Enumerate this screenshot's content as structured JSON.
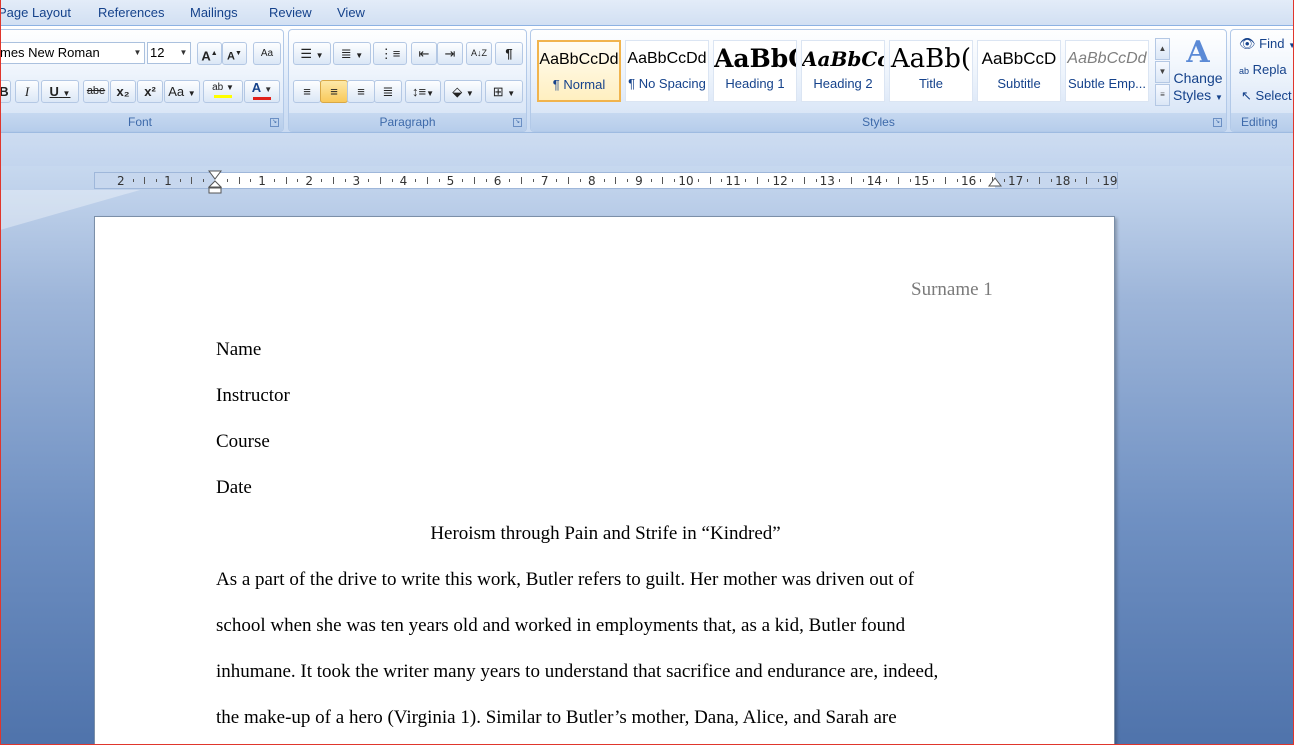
{
  "tabs": [
    "Page Layout",
    "References",
    "Mailings",
    "Review",
    "View"
  ],
  "font": {
    "name": "mes New Roman",
    "size": "12",
    "group_label": "Font",
    "grow": "A",
    "shrink": "A",
    "clear": "Aa",
    "bold": "B",
    "italic": "I",
    "underline": "U",
    "strike": "abe",
    "sub": "x₂",
    "sup": "x²",
    "case": "Aa",
    "highlight": "ab",
    "color": "A"
  },
  "paragraph": {
    "group_label": "Paragraph",
    "pilcrow": "¶",
    "sort": "A↓Z"
  },
  "styles": {
    "group_label": "Styles",
    "items": [
      {
        "preview": "AaBbCcDd",
        "name": "¶ Normal"
      },
      {
        "preview": "AaBbCcDd",
        "name": "¶ No Spacing"
      },
      {
        "preview": "AaBbC",
        "name": "Heading 1"
      },
      {
        "preview": "AaBbCc",
        "name": "Heading 2"
      },
      {
        "preview": "AaBb(",
        "name": "Title"
      },
      {
        "preview": "AaBbCcD",
        "name": "Subtitle"
      },
      {
        "preview": "AaBbCcDd",
        "name": "Subtle Emp..."
      }
    ],
    "change_line1": "Change",
    "change_line2": "Styles"
  },
  "editing": {
    "group_label": "Editing",
    "find": "Find",
    "replace": "Repla",
    "select": "Select"
  },
  "ruler": {
    "numbers_left": [
      "2",
      "1"
    ],
    "numbers_right": [
      "1",
      "2",
      "3",
      "4",
      "5",
      "6",
      "7",
      "8",
      "9",
      "10",
      "11",
      "12",
      "13",
      "14",
      "15",
      "16",
      "17",
      "18",
      "19"
    ]
  },
  "document": {
    "header": "Surname 1",
    "lines": [
      "Name",
      "Instructor",
      "Course",
      "Date"
    ],
    "title": "Heroism through Pain and Strife in “Kindred”",
    "body": [
      "As a part of the drive to write this work, Butler refers to guilt. Her mother was driven out of",
      "school when she was ten years old and worked in employments that, as a kid, Butler found",
      "inhumane. It took the writer many years to understand that sacrifice and endurance are, indeed,",
      "the make-up of a hero (Virginia 1). Similar to Butler’s mother, Dana, Alice, and Sarah are"
    ]
  },
  "colors": {
    "highlight": "#ffff00",
    "font_color": "#e0201a",
    "accent": "#15428b"
  }
}
